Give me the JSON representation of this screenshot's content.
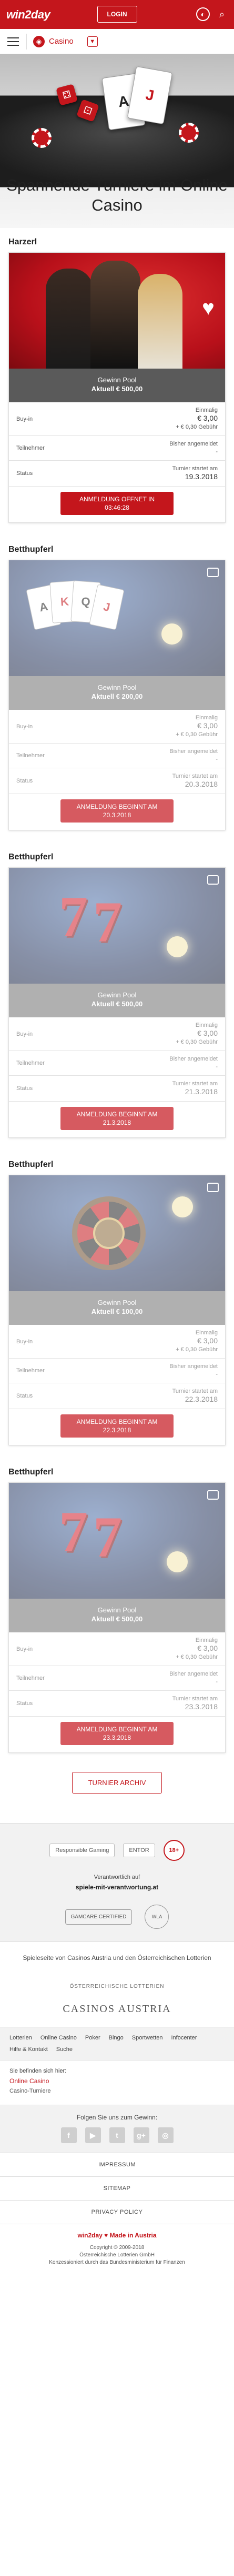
{
  "header": {
    "logo": "win2day",
    "login_label": "LOGIN"
  },
  "subnav": {
    "category_label": "Casino"
  },
  "hero": {
    "title": "Spannende Turniere im Online Casino"
  },
  "labels": {
    "pool": "Gewinn Pool",
    "buyin": "Buy-in",
    "participants": "Teilnehmer",
    "status": "Status",
    "entry": "Einmalig",
    "fee_note": "+ € 0,30 Gebühr",
    "no_registered": "Bisher angemeldet",
    "dash": "-",
    "starts": "Turnier startet am"
  },
  "tournaments": [
    {
      "heading": "Harzerl",
      "pool": "Aktuell € 500,00",
      "buyin": "€ 3,00",
      "start": "19.3.2018",
      "cta1": "ANMELDUNG OFFNET IN",
      "cta2": "03:46:28"
    },
    {
      "heading": "Betthupferl",
      "pool": "Aktuell € 200,00",
      "buyin": "€ 3,00",
      "start": "20.3.2018",
      "cta1": "ANMELDUNG BEGINNT AM",
      "cta2": "20.3.2018"
    },
    {
      "heading": "Betthupferl",
      "pool": "Aktuell € 500,00",
      "buyin": "€ 3,00",
      "start": "21.3.2018",
      "cta1": "ANMELDUNG BEGINNT AM",
      "cta2": "21.3.2018"
    },
    {
      "heading": "Betthupferl",
      "pool": "Aktuell € 100,00",
      "buyin": "€ 3,00",
      "start": "22.3.2018",
      "cta1": "ANMELDUNG BEGINNT AM",
      "cta2": "22.3.2018"
    },
    {
      "heading": "Betthupferl",
      "pool": "Aktuell € 500,00",
      "buyin": "€ 3,00",
      "start": "23.3.2018",
      "cta1": "ANMELDUNG BEGINNT AM",
      "cta2": "23.3.2018"
    }
  ],
  "archive_label": "TURNIER ARCHIV",
  "footer": {
    "logo_left": "Responsible Gaming",
    "logo_mid": "ENTOR",
    "logo_right": "18+",
    "resp_text": "Verantwortlich auf",
    "resp_link": "spiele-mit-verantwortung.at",
    "badge_left": "GAMCARE CERTIFIED",
    "badge_right": "WLA",
    "note": "Spieleseite von Casinos Austria und den Österreichischen Lotterien",
    "lotterien": "ÖSTERREICHISCHE LOTTERIEN",
    "casinos": "CASINOS AUSTRIA",
    "nav": [
      "Lotterien",
      "Online Casino",
      "Poker",
      "Bingo",
      "Sportwetten",
      "Infocenter",
      "Hilfe & Kontakt",
      "Suche"
    ],
    "bc_title": "Sie befinden sich hier:",
    "bc_link": "Online Casino",
    "bc_current": "Casino-Turniere",
    "social_title": "Folgen Sie uns zum Gewinn:",
    "social": [
      "f",
      "▶",
      "t",
      "g+",
      "◎"
    ],
    "legal": [
      "IMPRESSUM",
      "SITEMAP",
      "PRIVACY POLICY"
    ],
    "made_in": "win2day ♥ Made in Austria",
    "copy1": "Copyright © 2009-2018",
    "copy2": "Österreichische Lotterien GmbH",
    "copy3": "Konzessioniert durch das Bundesministerium für Finanzen"
  }
}
